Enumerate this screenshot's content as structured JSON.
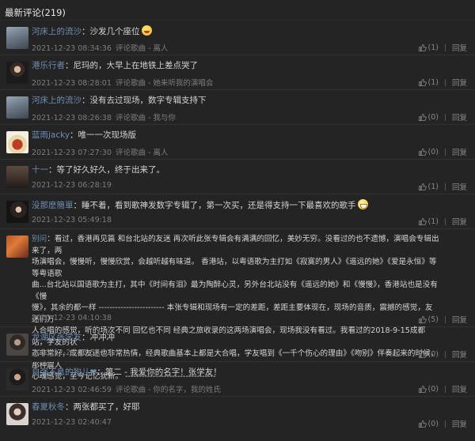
{
  "header": {
    "title": "最新评论(219)"
  },
  "labels": {
    "reply": "回复",
    "separator": "："
  },
  "comments": [
    {
      "user": "河床上的流沙",
      "text": "沙发几个座位",
      "time": "2021-12-23 08:34:36",
      "source": "评论歌曲 - 离人",
      "likes": "(1)"
    },
    {
      "user": "港乐行者",
      "text": "尼玛的，大早上在地铁上差点哭了",
      "time": "2021-12-23 08:28:01",
      "source": "评论歌曲 - 她来听我的演唱会",
      "likes": "(1)"
    },
    {
      "user": "河床上的流沙",
      "text": "没有去过现场，数字专辑支持下",
      "time": "2021-12-23 08:26:38",
      "source": "评论歌曲 - 我与你",
      "likes": "(0)"
    },
    {
      "user": "蓝雨jacky",
      "text": "唯一一次现场版",
      "time": "2021-12-23 07:27:30",
      "source": "评论歌曲 - 离人",
      "likes": "(0)"
    },
    {
      "user": "十一",
      "text": "等了好久好久，终于出来了。",
      "time": "2021-12-23 06:28:19",
      "source": "",
      "likes": "(1)"
    },
    {
      "user": "没那麽簡單",
      "text": "睡不着，看到歌神发数字专辑了，第一次买，还是得支持一下最喜欢的歌手",
      "time": "2021-12-23 05:49:18",
      "source": "",
      "likes": "(1)"
    },
    {
      "user": "别问",
      "lines": [
        "看过，香港再见篇 和台北站的友迷 再次听此张专辑会有满满的回忆，美妙无穷。没看过的也不遗憾，演唱会专辑出来了，两",
        "场演唱会，慢慢听，慢慢欣赏，会越听越有味道。 香港站，以粤语歌为主打如《寂寞的男人》《遥远的她》《爱是永恒》等等粤语歌",
        "曲...台北站以国语歌为主打，其中《时间有泪》最为陶醉心灵，另外台北站没有《遥远的她》和《慢慢》，香港站也是没有《慢",
        "慢》，其余的都一样 ------------------------ 本张专辑和现场有一定的差距，差距主要体现在，现场的音质，震撼的感觉，友迷们万",
        "人合唱的感觉，听的场次不同 回忆也不同 经典之旅收录的这两场演唱会，现场我没有看过。我看过的2018-9-15成都站，学友的状",
        "态非常好，成都友迷也非常热情，经典歌曲基本上都是大合唱，学友唱到《一千个伤心的理由》《吻别》伴奏起来的时候，那种震人",
        "心魂感觉，至今记忆犹新。 ---------------------------------"
      ],
      "time": "2021-12-23 04:10:38",
      "source": "",
      "likes": "(5)"
    },
    {
      "user": "龙湖区张学友",
      "text": "冲冲冲",
      "time": "2021-12-23 03:57:23",
      "source": "",
      "likes": "(0)"
    },
    {
      "user": "自强不息的狗儿❤",
      "text": "第二 - 我爱你的名字！张学友！",
      "time": "2021-12-23 02:46:59",
      "source": "评论歌曲 - 你的名字，我的姓氏",
      "likes": "(0)"
    },
    {
      "user": "春夏秋冬",
      "text": "两张都买了，好耶",
      "time": "2021-12-23 02:40:47",
      "source": "",
      "likes": "(0)"
    }
  ]
}
